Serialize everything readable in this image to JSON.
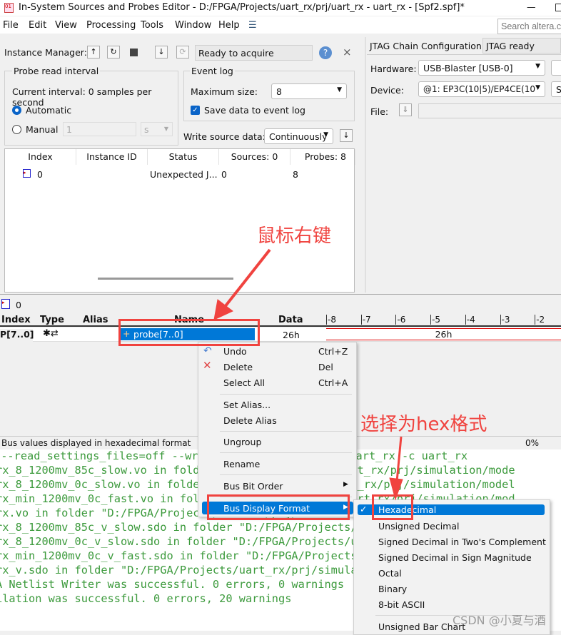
{
  "window": {
    "title": "In-System Sources and Probes Editor - D:/FPGA/Projects/uart_rx/prj/uart_rx - uart_rx - [Spf2.spf]*",
    "minimize": "—"
  },
  "menu": [
    "File",
    "Edit",
    "View",
    "Processing",
    "Tools",
    "Window",
    "Help"
  ],
  "search": {
    "placeholder": "Search altera.com"
  },
  "instance_manager": {
    "label": "Instance Manager:",
    "status": "Ready to acquire",
    "close": "×"
  },
  "probe_interval": {
    "title": "Probe read interval",
    "current": "Current interval:  0 samples per second",
    "automatic": "Automatic",
    "manual": "Manual",
    "manual_value": "1",
    "unit": "s",
    "selected": "Automatic"
  },
  "event_log": {
    "title": "Event log",
    "max_size_label": "Maximum size:",
    "max_size": "8",
    "save_label": "Save data to event log",
    "save_checked": true
  },
  "write_source": {
    "label": "Write source data:",
    "value": "Continuously"
  },
  "instances": {
    "headers": [
      "Index",
      "Instance ID",
      "Status",
      "Sources: 0",
      "Probes: 8"
    ],
    "rows": [
      {
        "index": "0",
        "id": "",
        "status": "Unexpected J...",
        "sources": "0",
        "probes": "8"
      }
    ]
  },
  "jtag": {
    "label": "JTAG Chain Configuration:",
    "status": "JTAG ready",
    "hardware_label": "Hardware:",
    "hardware": "USB-Blaster [USB-0]",
    "device_label": "Device:",
    "device": "@1: EP3C(10|5)/EP4CE(10",
    "device_extra": "S",
    "file_label": "File:"
  },
  "signals": {
    "instance": "0",
    "headers": [
      "Index",
      "Type",
      "Alias",
      "Name",
      "Data"
    ],
    "ticks": [
      "-8",
      "-7",
      "-6",
      "-5",
      "-4",
      "-3",
      "-2"
    ],
    "rows": [
      {
        "index": "P[7..0]",
        "alias": "",
        "name": "probe[7..0]",
        "data": "26h",
        "wave": "26h"
      }
    ]
  },
  "statusbar": {
    "text": "Bus values displayed in hexadecimal format",
    "progress": "0%"
  },
  "console": [
    " --read_settings_files=off --write_settings_files=off uart_rx -c uart_rx",
    "rx_8_1200mv_85c_slow.vo in folder \"D:/FPGA/Projects/uart_rx/prj/simulation/mode",
    "rx_8_1200mv_0c_slow.vo in folder \"D:/FPGA/Projects/uart_rx/prj/simulation/model",
    "rx_min_1200mv_0c_fast.vo in folder \"D:/FPGA/Projects/uart_rx/prj/simulation/mod",
    "rx.vo in folder \"D:/FPGA/Projects/uart_rx/prj/simulation/modelsim/\" for EDA sim",
    "rx_8_1200mv_85c_v_slow.sdo in folder \"D:/FPGA/Projects/uart_rx/prj/simulation/m",
    "rx_8_1200mv_0c_v_slow.sdo in folder \"D:/FPGA/Projects/uart_rx/prj/simulation/mo",
    "rx_min_1200mv_0c_v_fast.sdo in folder \"D:/FPGA/Projects/uart_rx/prj/simulation/",
    "rx_v.sdo in folder \"D:/FPGA/Projects/uart_rx/prj/simulation/modelsim/\" for EDA ",
    "A Netlist Writer was successful. 0 errors, 0 warnings",
    "ilation was successful. 0 errors, 20 warnings"
  ],
  "context_menu": {
    "items": [
      {
        "label": "Undo",
        "shortcut": "Ctrl+Z"
      },
      {
        "label": "Delete",
        "shortcut": "Del"
      },
      {
        "label": "Select All",
        "shortcut": "Ctrl+A"
      },
      {
        "label": "Set Alias..."
      },
      {
        "label": "Delete Alias"
      },
      {
        "label": "Ungroup"
      },
      {
        "label": "Rename"
      },
      {
        "label": "Bus Bit Order"
      },
      {
        "label": "Bus Display Format"
      }
    ]
  },
  "submenu": {
    "selected": "Hexadecimal",
    "items": [
      "Hexadecimal",
      "Unsigned Decimal",
      "Signed Decimal in Two's Complement",
      "Signed Decimal in Sign Magnitude",
      "Octal",
      "Binary",
      "8-bit ASCII",
      "Unsigned Bar Chart"
    ]
  },
  "annotations": {
    "right_click": "鼠标右键",
    "choose_hex": "选择为hex格式"
  },
  "watermark": "CSDN @小夏与酒",
  "colors": {
    "accent": "#0078d7",
    "annotation": "#f0433f",
    "console_text": "#3c9a3c"
  }
}
